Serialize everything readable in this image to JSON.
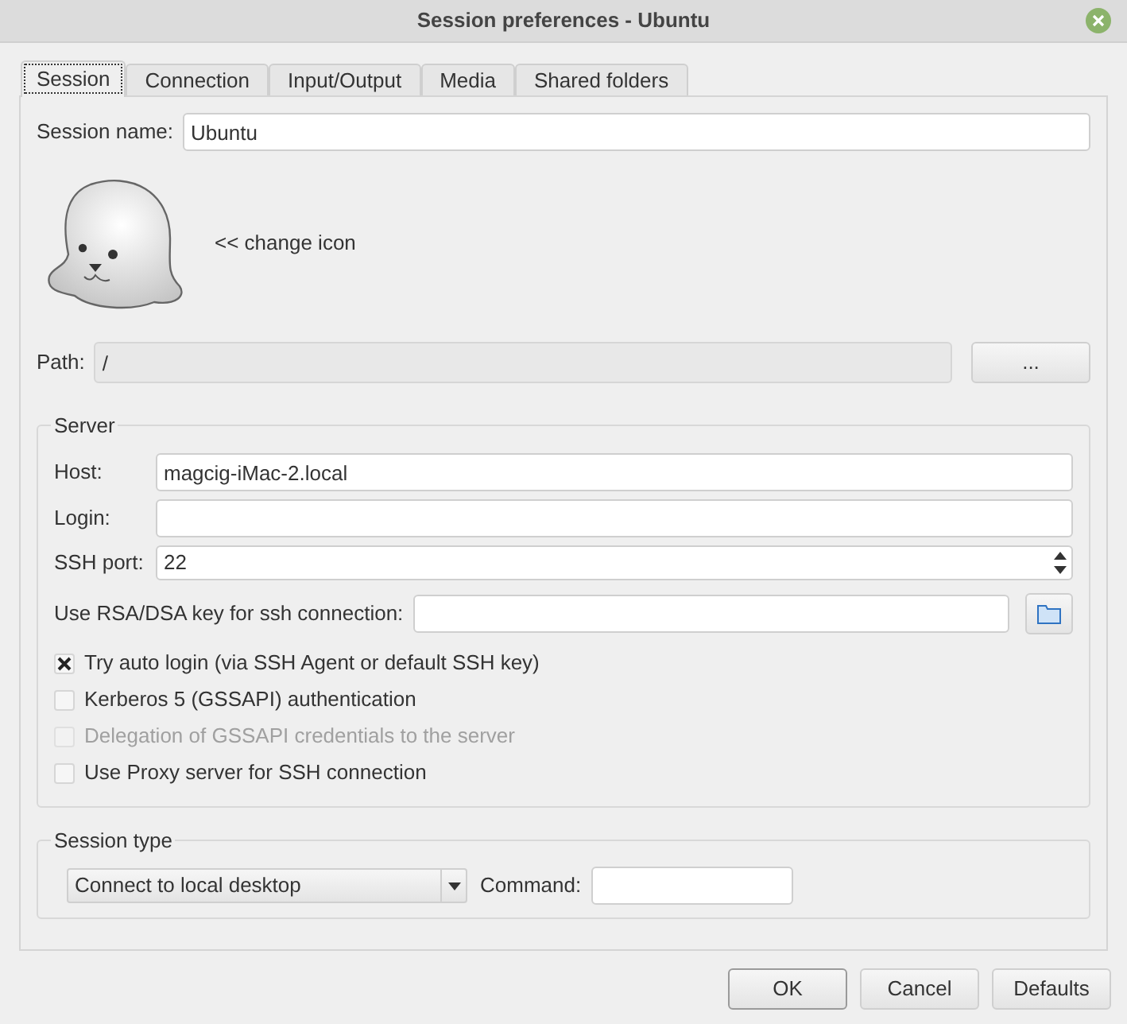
{
  "window": {
    "title": "Session preferences - Ubuntu"
  },
  "tabs": [
    {
      "label": "Session",
      "selected": true
    },
    {
      "label": "Connection",
      "selected": false
    },
    {
      "label": "Input/Output",
      "selected": false
    },
    {
      "label": "Media",
      "selected": false
    },
    {
      "label": "Shared folders",
      "selected": false
    }
  ],
  "session_name": {
    "label": "Session name:",
    "value": "Ubuntu"
  },
  "change_icon": "<< change icon",
  "path": {
    "label": "Path:",
    "value": "/",
    "button": "..."
  },
  "server": {
    "title": "Server",
    "host": {
      "label": "Host:",
      "value": "magcig-iMac-2.local"
    },
    "login": {
      "label": "Login:"
    },
    "ssh_port": {
      "label": "SSH port:",
      "value": "22"
    },
    "key": {
      "label": "Use RSA/DSA key for ssh connection:"
    },
    "options": [
      {
        "label": "Try auto login (via SSH Agent or default SSH key)",
        "checked": true,
        "disabled": false
      },
      {
        "label": "Kerberos 5 (GSSAPI) authentication",
        "checked": false,
        "disabled": false
      },
      {
        "label": "Delegation of GSSAPI credentials to the server",
        "checked": false,
        "disabled": true
      },
      {
        "label": "Use Proxy server for SSH connection",
        "checked": false,
        "disabled": false
      }
    ]
  },
  "session_type": {
    "title": "Session type",
    "value": "Connect to local desktop",
    "command_label": "Command:"
  },
  "buttons": [
    {
      "label": "OK",
      "default": true
    },
    {
      "label": "Cancel",
      "default": false
    },
    {
      "label": "Defaults",
      "default": false
    }
  ]
}
